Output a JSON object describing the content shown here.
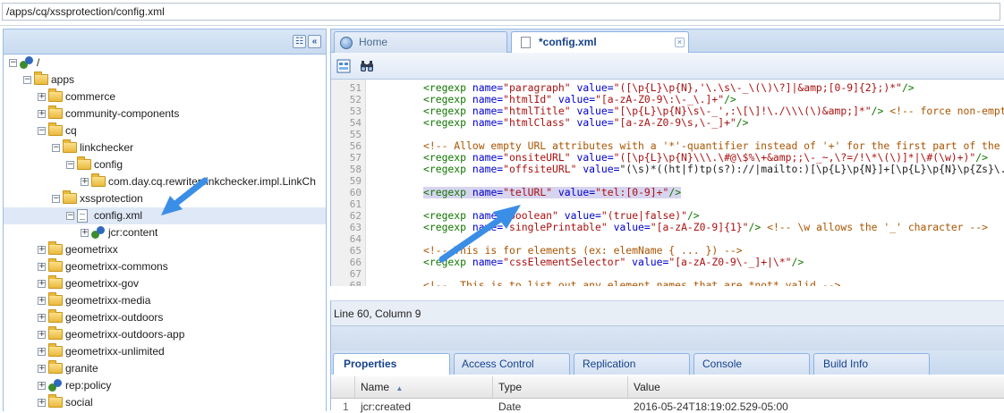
{
  "path_field": {
    "value": "/apps/cq/xssprotection/config.xml"
  },
  "tree": {
    "nodes": [
      {
        "label": "/",
        "icon": "node-icon"
      },
      {
        "label": "apps",
        "icon": "folder-icon"
      },
      {
        "label": "commerce",
        "icon": "folder-icon"
      },
      {
        "label": "community-components",
        "icon": "folder-icon"
      },
      {
        "label": "cq",
        "icon": "folder-icon"
      },
      {
        "label": "linkchecker",
        "icon": "folder-icon"
      },
      {
        "label": "config",
        "icon": "folder-icon"
      },
      {
        "label": "com.day.cq.rewriter.linkchecker.impl.LinkCh",
        "icon": "folder-icon"
      },
      {
        "label": "xssprotection",
        "icon": "folder-icon"
      },
      {
        "label": "config.xml",
        "icon": "file-icon",
        "selected": true
      },
      {
        "label": "jcr:content",
        "icon": "node-icon"
      },
      {
        "label": "geometrixx",
        "icon": "folder-icon"
      },
      {
        "label": "geometrixx-commons",
        "icon": "folder-icon"
      },
      {
        "label": "geometrixx-gov",
        "icon": "folder-icon"
      },
      {
        "label": "geometrixx-media",
        "icon": "folder-icon"
      },
      {
        "label": "geometrixx-outdoors",
        "icon": "folder-icon"
      },
      {
        "label": "geometrixx-outdoors-app",
        "icon": "folder-icon"
      },
      {
        "label": "geometrixx-unlimited",
        "icon": "folder-icon"
      },
      {
        "label": "granite",
        "icon": "folder-icon"
      },
      {
        "label": "rep:policy",
        "icon": "node-icon"
      },
      {
        "label": "social",
        "icon": "folder-icon"
      }
    ]
  },
  "editor_tabs": [
    {
      "label": "Home",
      "icon": "home-icon"
    },
    {
      "label": "*config.xml",
      "icon": "file-icon",
      "active": true
    }
  ],
  "editor": {
    "lines": [
      {
        "n": "51",
        "text": "<regexp name=\"paragraph\" value=\"([\\p{L}\\p{N},'\\.\\s\\-_\\(\\)\\?]|&amp;[0-9]{2};)*\"/>"
      },
      {
        "n": "52",
        "text": "<regexp name=\"htmlId\" value=\"[a-zA-Z0-9\\:\\-_\\.]+\"/>"
      },
      {
        "n": "53",
        "text": "<regexp name=\"htmlTitle\" value=\"[\\p{L}\\p{N}\\s\\-_',:\\[\\]!\\./\\\\\\(\\)&amp;]*\"/> <!-- force non-empty with"
      },
      {
        "n": "54",
        "text": "<regexp name=\"htmlClass\" value=\"[a-zA-Z0-9\\s,\\-_]+\"/>"
      },
      {
        "n": "55",
        "text": ""
      },
      {
        "n": "56",
        "text": "<!-- Allow empty URL attributes with a '*'-quantifier instead of '+' for the first part of the"
      },
      {
        "n": "57",
        "text": "<regexp name=\"onsiteURL\" value=\"([\\p{L}\\p{N}\\\\\\.\\#@\\$%\\+&amp;;\\-_~,\\?=/!\\*\\(\\)]*|\\#(\\w)+)\"/>"
      },
      {
        "n": "58",
        "text": "<regexp name=\"offsiteURL\" value=\"(\\s)*((ht|f)tp(s?)://|mailto:)[\\p{L}\\p{N}]+[\\p{L}\\p{N}\\p{Zs}\\.\\#"
      },
      {
        "n": "59",
        "text": ""
      },
      {
        "n": "60",
        "text": "<regexp name=\"telURL\" value=\"tel:[0-9]+\"/>",
        "highlight": true
      },
      {
        "n": "61",
        "text": ""
      },
      {
        "n": "62",
        "text": "<regexp name=\"boolean\" value=\"(true|false)\"/>"
      },
      {
        "n": "63",
        "text": "<regexp name=\"singlePrintable\" value=\"[a-zA-Z0-9]{1}\"/> <!-- \\w allows the '_' character -->"
      },
      {
        "n": "64",
        "text": ""
      },
      {
        "n": "65",
        "text": "<!-- This is for elements (ex: elemName { ... }) -->"
      },
      {
        "n": "66",
        "text": "<regexp name=\"cssElementSelector\" value=\"[a-zA-Z0-9\\-_]+|\\*\"/>"
      },
      {
        "n": "67",
        "text": ""
      },
      {
        "n": "68",
        "text": "<!--  This is to list out any element names that are *not* valid -->"
      }
    ]
  },
  "status": {
    "position": "Line 60, Column 9"
  },
  "bottom_tabs": [
    {
      "label": "Properties",
      "active": true
    },
    {
      "label": "Access Control"
    },
    {
      "label": "Replication"
    },
    {
      "label": "Console"
    },
    {
      "label": "Build Info"
    }
  ],
  "grid": {
    "headers": {
      "name": "Name",
      "type": "Type",
      "value": "Value"
    },
    "rows": [
      {
        "index": "1",
        "name": "jcr:created",
        "type": "Date",
        "value": "2016-05-24T18:19:02.529-05:00"
      }
    ]
  },
  "colors": {
    "accent_arrow": "#3a8ee6",
    "selection": "#dfe8f6",
    "highlight": "#d7d4f0"
  }
}
